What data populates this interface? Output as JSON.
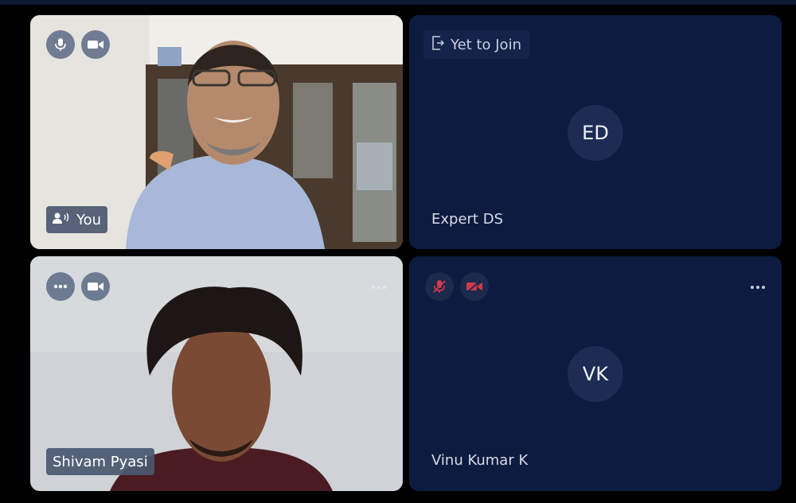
{
  "participants": [
    {
      "name": "You",
      "mic": "mic-on",
      "camera": "camera-on",
      "speaking": true
    },
    {
      "name": "Expert DS",
      "initials": "ED",
      "status": "Yet to Join",
      "status_icon": "exit-door-icon"
    },
    {
      "name": "Shivam Pyasi",
      "mic": "more-options",
      "camera": "camera-on"
    },
    {
      "name": "Vinu Kumar K",
      "initials": "VK",
      "mic": "mic-off",
      "camera": "camera-off"
    }
  ],
  "colors": {
    "tile_background": "#0c1b3f",
    "avatar_background": "#1c2c55",
    "muted_icon": "#d23b4b",
    "name_tag": "#4a5870"
  }
}
